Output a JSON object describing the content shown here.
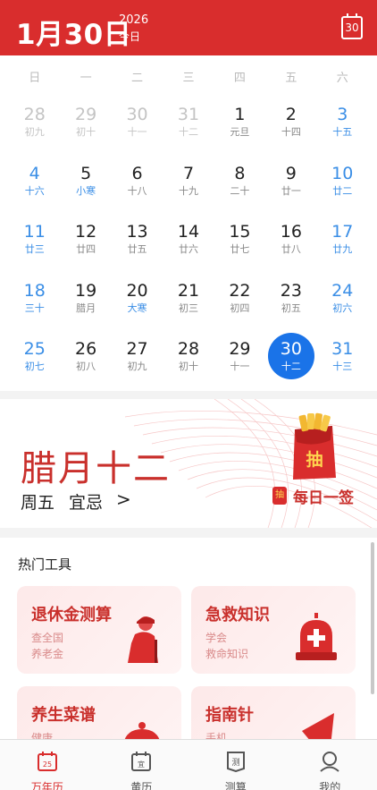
{
  "header": {
    "date": "1月30日",
    "year": "2026",
    "today_label": "今日",
    "today_button": "30"
  },
  "calendar": {
    "weekdays": [
      "日",
      "一",
      "二",
      "三",
      "四",
      "五",
      "六"
    ],
    "days": [
      {
        "num": "28",
        "lunar": "初九",
        "kind": "other"
      },
      {
        "num": "29",
        "lunar": "初十",
        "kind": "other"
      },
      {
        "num": "30",
        "lunar": "十一",
        "kind": "other"
      },
      {
        "num": "31",
        "lunar": "十二",
        "kind": "other"
      },
      {
        "num": "1",
        "lunar": "元旦",
        "kind": "normal"
      },
      {
        "num": "2",
        "lunar": "十四",
        "kind": "normal"
      },
      {
        "num": "3",
        "lunar": "十五",
        "kind": "weekend"
      },
      {
        "num": "4",
        "lunar": "十六",
        "kind": "weekend"
      },
      {
        "num": "5",
        "lunar": "小寒",
        "kind": "normal",
        "term": true
      },
      {
        "num": "6",
        "lunar": "十八",
        "kind": "normal"
      },
      {
        "num": "7",
        "lunar": "十九",
        "kind": "normal"
      },
      {
        "num": "8",
        "lunar": "二十",
        "kind": "normal"
      },
      {
        "num": "9",
        "lunar": "廿一",
        "kind": "normal"
      },
      {
        "num": "10",
        "lunar": "廿二",
        "kind": "weekend"
      },
      {
        "num": "11",
        "lunar": "廿三",
        "kind": "weekend"
      },
      {
        "num": "12",
        "lunar": "廿四",
        "kind": "normal"
      },
      {
        "num": "13",
        "lunar": "廿五",
        "kind": "normal"
      },
      {
        "num": "14",
        "lunar": "廿六",
        "kind": "normal"
      },
      {
        "num": "15",
        "lunar": "廿七",
        "kind": "normal"
      },
      {
        "num": "16",
        "lunar": "廿八",
        "kind": "normal"
      },
      {
        "num": "17",
        "lunar": "廿九",
        "kind": "weekend"
      },
      {
        "num": "18",
        "lunar": "三十",
        "kind": "weekend"
      },
      {
        "num": "19",
        "lunar": "腊月",
        "kind": "normal"
      },
      {
        "num": "20",
        "lunar": "大寒",
        "kind": "normal",
        "term": true
      },
      {
        "num": "21",
        "lunar": "初三",
        "kind": "normal"
      },
      {
        "num": "22",
        "lunar": "初四",
        "kind": "normal"
      },
      {
        "num": "23",
        "lunar": "初五",
        "kind": "normal"
      },
      {
        "num": "24",
        "lunar": "初六",
        "kind": "weekend"
      },
      {
        "num": "25",
        "lunar": "初七",
        "kind": "weekend"
      },
      {
        "num": "26",
        "lunar": "初八",
        "kind": "normal"
      },
      {
        "num": "27",
        "lunar": "初九",
        "kind": "normal"
      },
      {
        "num": "28",
        "lunar": "初十",
        "kind": "normal"
      },
      {
        "num": "29",
        "lunar": "十一",
        "kind": "normal"
      },
      {
        "num": "30",
        "lunar": "十二",
        "kind": "selected"
      },
      {
        "num": "31",
        "lunar": "十三",
        "kind": "weekend"
      }
    ]
  },
  "banner": {
    "lunar_date": "腊月十二",
    "weekday": "周五",
    "yiji": "宜忌",
    "chevron": ">",
    "envelope_char": "抽",
    "daily_tag": "抽",
    "daily_label": "每日一签"
  },
  "tools": {
    "title": "热门工具",
    "items": [
      {
        "name": "退休金测算",
        "sub1": "查全国",
        "sub2": "养老金",
        "icon": "elderly-person-icon"
      },
      {
        "name": "急救知识",
        "sub1": "学会",
        "sub2": "救命知识",
        "icon": "emergency-siren-icon"
      },
      {
        "name": "养生菜谱",
        "sub1": "健康",
        "sub2": "",
        "icon": "food-cloche-icon"
      },
      {
        "name": "指南针",
        "sub1": "手机",
        "sub2": "",
        "icon": "compass-icon"
      }
    ]
  },
  "tabbar": {
    "tabs": [
      {
        "label": "万年历",
        "active": true,
        "icon": "calendar-icon",
        "glyph": "25"
      },
      {
        "label": "黄历",
        "active": false,
        "icon": "almanac-icon",
        "glyph": "宜"
      },
      {
        "label": "测算",
        "active": false,
        "icon": "fortune-icon",
        "glyph": "测"
      },
      {
        "label": "我的",
        "active": false,
        "icon": "profile-icon",
        "glyph": ""
      }
    ]
  },
  "colors": {
    "brand_red": "#d92d2d",
    "selected_blue": "#1a73e8",
    "weekend_blue": "#3a8ee6"
  }
}
